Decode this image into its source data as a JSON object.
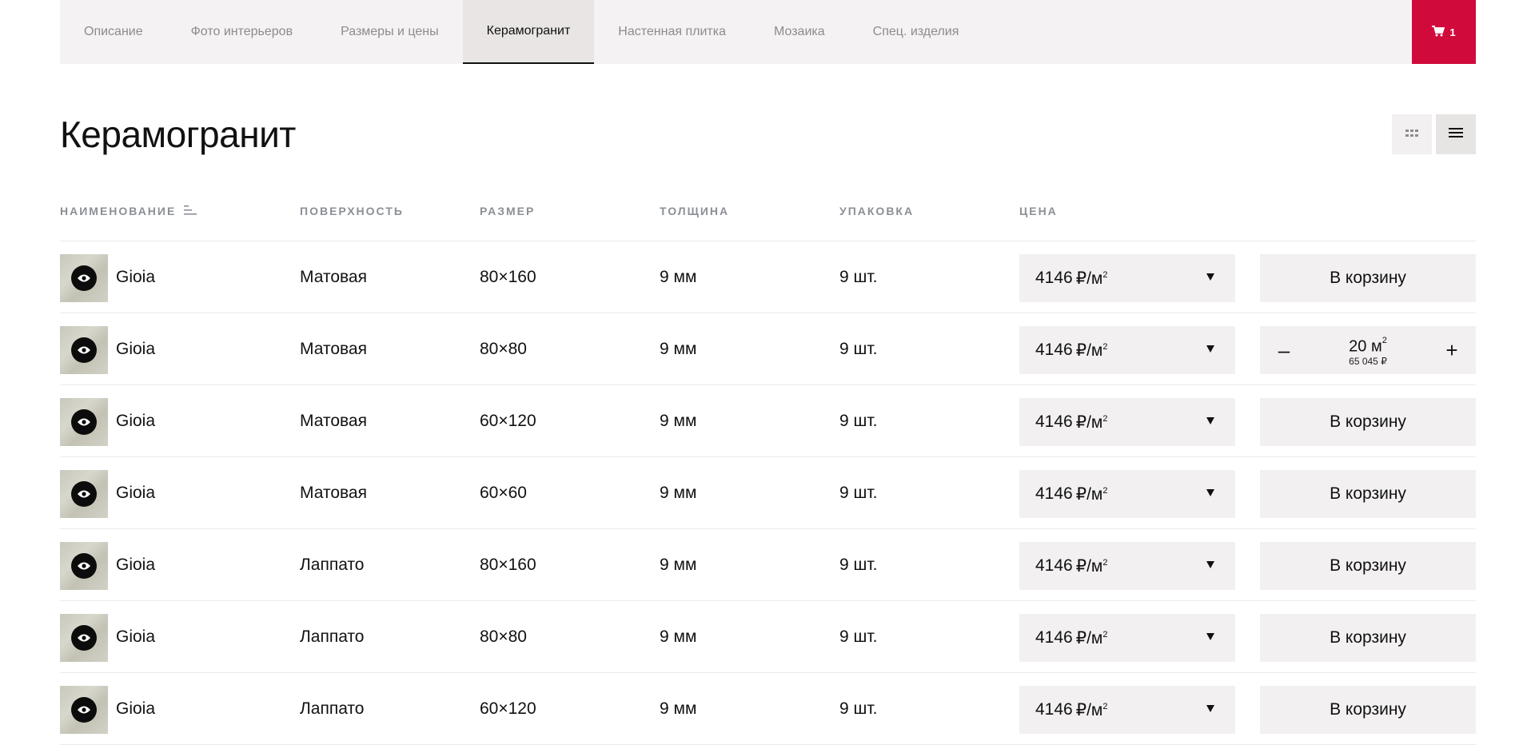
{
  "tabs": [
    {
      "label": "Описание",
      "active": false
    },
    {
      "label": "Фото интерьеров",
      "active": false
    },
    {
      "label": "Размеры и цены",
      "active": false
    },
    {
      "label": "Керамогранит",
      "active": true
    },
    {
      "label": "Настенная плитка",
      "active": false
    },
    {
      "label": "Мозаика",
      "active": false
    },
    {
      "label": "Спец. изделия",
      "active": false
    }
  ],
  "cart": {
    "count": "1",
    "icon": "cart-icon",
    "color": "#d10a3c"
  },
  "page": {
    "title": "Керамогранит"
  },
  "view_toggle": {
    "grid_icon": "grid-icon",
    "list_icon": "list-icon",
    "active": "list"
  },
  "columns": {
    "name": "НАИМЕНОВАНИЕ",
    "surface": "ПОВЕРХНОСТЬ",
    "size": "РАЗМЕР",
    "thickness": "ТОЛЩИНА",
    "package": "УПАКОВКА",
    "price": "ЦЕНА",
    "sort_icon": "sort-icon"
  },
  "price_unit": "₽/м",
  "price_unit_sup": "2",
  "buy_label": "В корзину",
  "rows": [
    {
      "name": "Gioia",
      "surface": "Матовая",
      "size": "80×160",
      "thickness": "9 мм",
      "package": "9 шт.",
      "price": "4146"
    },
    {
      "name": "Gioia",
      "surface": "Матовая",
      "size": "80×80",
      "thickness": "9 мм",
      "package": "9 шт.",
      "price": "4146",
      "in_cart": {
        "qty": "20 м",
        "qty_sup": "2",
        "total": "65 045 ₽",
        "minus": "–",
        "plus": "+"
      }
    },
    {
      "name": "Gioia",
      "surface": "Матовая",
      "size": "60×120",
      "thickness": "9 мм",
      "package": "9 шт.",
      "price": "4146"
    },
    {
      "name": "Gioia",
      "surface": "Матовая",
      "size": "60×60",
      "thickness": "9 мм",
      "package": "9 шт.",
      "price": "4146"
    },
    {
      "name": "Gioia",
      "surface": "Лаппато",
      "size": "80×160",
      "thickness": "9 мм",
      "package": "9 шт.",
      "price": "4146"
    },
    {
      "name": "Gioia",
      "surface": "Лаппато",
      "size": "80×80",
      "thickness": "9 мм",
      "package": "9 шт.",
      "price": "4146"
    },
    {
      "name": "Gioia",
      "surface": "Лаппато",
      "size": "60×120",
      "thickness": "9 мм",
      "package": "9 шт.",
      "price": "4146"
    }
  ]
}
